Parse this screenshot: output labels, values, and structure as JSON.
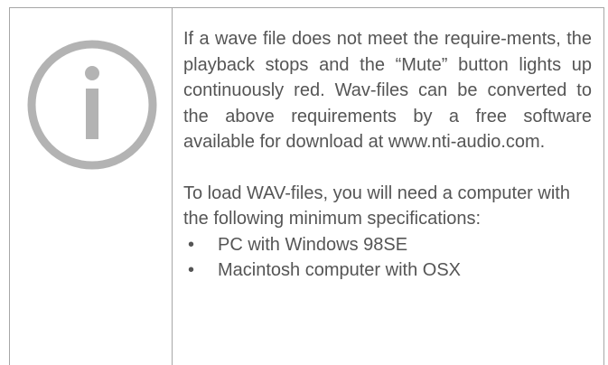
{
  "note": {
    "icon": "info-icon",
    "paragraph1": "If a wave file does not meet the require-ments, the playback stops and the “Mute” button lights up continuously red. Wav-files can be converted to the above requirements by a free software available for download at www.nti-audio.com.",
    "paragraph2": "To load WAV-files, you will need a computer with the following minimum specifications:",
    "bullet_char": "•",
    "specs": [
      "PC with Windows 98SE",
      "Macintosh computer with OSX"
    ],
    "colors": {
      "border": "#a7a7a7",
      "icon": "#b3b3b3",
      "text": "#555555"
    }
  }
}
